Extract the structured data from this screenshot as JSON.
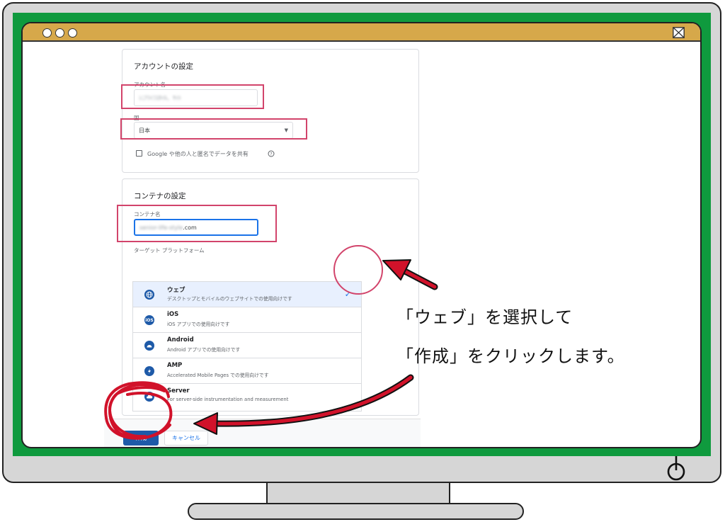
{
  "window": {
    "title_bar_color": "#d6a84a",
    "frame_color": "#0f9a3e",
    "traffic_dots": 3
  },
  "account_settings": {
    "title": "アカウントの設定",
    "account_name_label": "アカウント名",
    "account_name_value": "ｼﾆｱﾗｲﾌｽﾀｲﾙ、ｻｲﾄ",
    "country_label": "国",
    "country_value": "日本",
    "share_checkbox_label": "Google や他の人と匿名でデータを共有"
  },
  "container_settings": {
    "title": "コンテナの設定",
    "container_name_label": "コンテナ名",
    "container_name_blurred": "senior-life-style",
    "container_name_suffix": ".com",
    "platform_label": "ターゲット プラットフォーム",
    "platforms": [
      {
        "title": "ウェブ",
        "desc": "デスクトップとモバイルのウェブサイトでの使用向けです",
        "icon": "globe-icon",
        "selected": true
      },
      {
        "title": "iOS",
        "desc": "iOS アプリでの使用向けです",
        "icon": "ios-icon",
        "selected": false
      },
      {
        "title": "Android",
        "desc": "Android アプリでの使用向けです",
        "icon": "android-icon",
        "selected": false
      },
      {
        "title": "AMP",
        "desc": "Accelerated Mobile Pages での使用向けです",
        "icon": "amp-icon",
        "selected": false
      },
      {
        "title": "Server",
        "desc": "For server-side instrumentation and measurement",
        "icon": "cloud-icon",
        "selected": false
      }
    ]
  },
  "actions": {
    "create_label": "作成",
    "cancel_label": "キャンセル"
  },
  "instruction": {
    "line1": "「ウェブ」を選択して",
    "line2": "「作成」をクリックします。"
  },
  "colors": {
    "accent_blue": "#1e5aa8",
    "highlight_pink": "#d2446b",
    "annotation_red": "#d1122a"
  }
}
